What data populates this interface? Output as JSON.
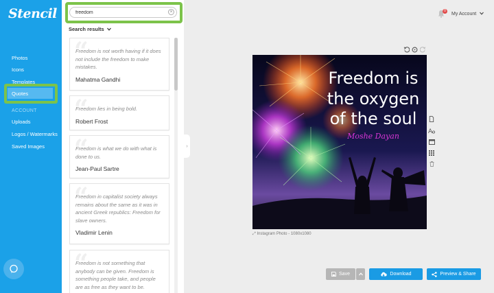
{
  "app": {
    "logo": "Stencil"
  },
  "nav": {
    "items": [
      {
        "label": "Photos"
      },
      {
        "label": "Icons"
      },
      {
        "label": "Templates"
      },
      {
        "label": "Quotes"
      }
    ],
    "section": "ACCOUNT",
    "account_items": [
      {
        "label": "Uploads"
      },
      {
        "label": "Logos / Watermarks"
      },
      {
        "label": "Saved Images"
      }
    ]
  },
  "search": {
    "value": "freedom",
    "results_label": "Search results"
  },
  "quotes": [
    {
      "text": "Freedom is not worth having if it does not include the freedom to make mistakes.",
      "author": "Mahatma Gandhi"
    },
    {
      "text": "Freedom lies in being bold.",
      "author": "Robert Frost"
    },
    {
      "text": "Freedom is what we do with what is done to us.",
      "author": "Jean-Paul Sartre"
    },
    {
      "text": "Freedom in capitalist society always remains about the same as it was in ancient Greek republics: Freedom for slave owners.",
      "author": "Vladimir Lenin"
    },
    {
      "text": "Freedom is not something that anybody can be given. Freedom is something people take, and people are as free as they want to be.",
      "author": ""
    }
  ],
  "header": {
    "notification_count": "0",
    "account_label": "My Account"
  },
  "canvas": {
    "quote_lines": [
      "Freedom is",
      "the oxygen",
      "of the soul"
    ],
    "author": "Moshe Dayan",
    "caption": "Instagram Photo - 1080x1080"
  },
  "buttons": {
    "save": "Save",
    "download": "Download",
    "share": "Preview & Share"
  },
  "colors": {
    "sidebar": "#1ba1e8",
    "highlight": "#7cc34a",
    "primary": "#1a9be4",
    "author_magenta": "#d936d6"
  },
  "icons": [
    "search-clear-icon",
    "chevron-down-icon",
    "bell-icon",
    "undo-icon",
    "redo-icon",
    "reset-icon",
    "page-icon",
    "text-icon",
    "frame-icon",
    "grid-icon",
    "trash-icon",
    "cloud-download-icon",
    "share-icon",
    "save-icon",
    "chat-icon"
  ]
}
